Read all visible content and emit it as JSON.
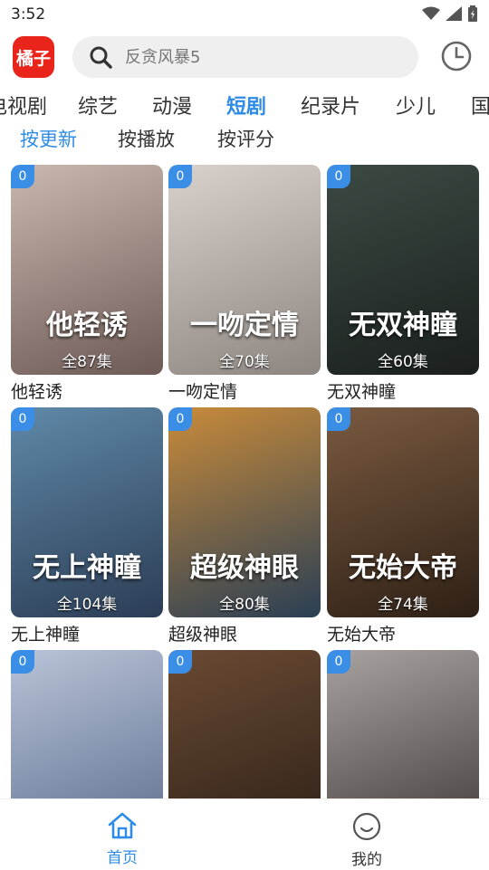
{
  "status_bar": {
    "time": "3:52"
  },
  "header": {
    "logo_text": "橘子",
    "search_placeholder": "反贪风暴5"
  },
  "categories": [
    {
      "label": "电视剧"
    },
    {
      "label": "综艺"
    },
    {
      "label": "动漫"
    },
    {
      "label": "短剧",
      "active": true
    },
    {
      "label": "纪录片"
    },
    {
      "label": "少儿"
    },
    {
      "label": "国"
    }
  ],
  "sort_tabs": [
    {
      "label": "按更新",
      "active": true
    },
    {
      "label": "按播放"
    },
    {
      "label": "按评分"
    }
  ],
  "items": [
    {
      "badge": "0",
      "episodes": "全87集",
      "name": "他轻诱",
      "poster_text": "他轻诱",
      "colors": [
        "#c9b8b0",
        "#6e5a55"
      ]
    },
    {
      "badge": "0",
      "episodes": "全70集",
      "name": "一吻定情",
      "poster_text": "一吻定情",
      "colors": [
        "#d9d2cc",
        "#8d8580"
      ]
    },
    {
      "badge": "0",
      "episodes": "全60集",
      "name": "无双神瞳",
      "poster_text": "无双神瞳",
      "colors": [
        "#3c4a44",
        "#1a1f1d"
      ]
    },
    {
      "badge": "0",
      "episodes": "全104集",
      "name": "无上神瞳",
      "poster_text": "无上神瞳",
      "colors": [
        "#5f89a8",
        "#2c3d55"
      ]
    },
    {
      "badge": "0",
      "episodes": "全80集",
      "name": "超级神眼",
      "poster_text": "超级神眼",
      "colors": [
        "#c98b3a",
        "#2a3f55"
      ]
    },
    {
      "badge": "0",
      "episodes": "全74集",
      "name": "无始大帝",
      "poster_text": "无始大帝",
      "colors": [
        "#7a5a40",
        "#2e2016"
      ]
    },
    {
      "badge": "0",
      "episodes": "",
      "name": "",
      "poster_text": "",
      "colors": [
        "#b9c3d8",
        "#5a6a8a"
      ]
    },
    {
      "badge": "0",
      "episodes": "",
      "name": "",
      "poster_text": "",
      "colors": [
        "#6a4a33",
        "#2a1e16"
      ]
    },
    {
      "badge": "0",
      "episodes": "",
      "name": "",
      "poster_text": "",
      "colors": [
        "#a8a2a0",
        "#3b3533"
      ]
    }
  ],
  "bottom_nav": {
    "home_label": "首页",
    "me_label": "我的"
  },
  "colors": {
    "accent": "#2f8ce6",
    "logo": "#e8241b",
    "badge": "#3a8ee6"
  }
}
